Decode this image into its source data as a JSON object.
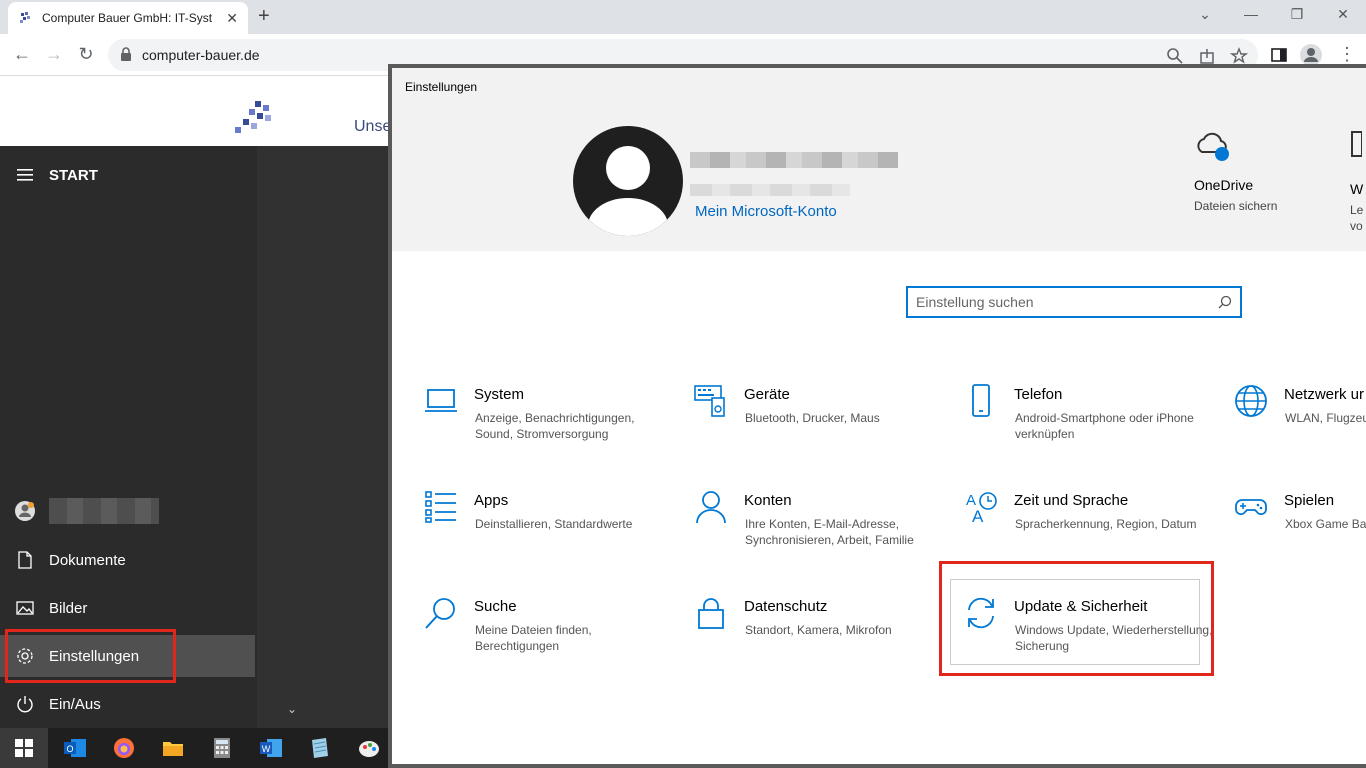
{
  "browser": {
    "tab_title": "Computer Bauer GmbH: IT-Syste",
    "url": "computer-bauer.de"
  },
  "page": {
    "partial_text": "Unse"
  },
  "start_menu": {
    "header": "START",
    "items": [
      {
        "label": "Dokumente",
        "icon": "document-icon"
      },
      {
        "label": "Bilder",
        "icon": "pictures-icon"
      },
      {
        "label": "Einstellungen",
        "icon": "gear-icon"
      },
      {
        "label": "Ein/Aus",
        "icon": "power-icon"
      }
    ]
  },
  "taskbar": {
    "apps": [
      "outlook-icon",
      "firefox-icon",
      "explorer-icon",
      "calculator-icon",
      "word-icon",
      "notepad-icon",
      "paint-icon"
    ]
  },
  "settings": {
    "window_title": "Einstellungen",
    "account_link": "Mein Microsoft-Konto",
    "onedrive": {
      "label": "OneDrive",
      "sub": "Dateien sichern"
    },
    "peek": {
      "label": "W",
      "sub1": "Le",
      "sub2": "vo"
    },
    "search_placeholder": "Einstellung suchen",
    "categories": [
      {
        "title": "System",
        "subtitle": "Anzeige, Benachrichtigungen, Sound, Stromversorgung"
      },
      {
        "title": "Geräte",
        "subtitle": "Bluetooth, Drucker, Maus"
      },
      {
        "title": "Telefon",
        "subtitle": "Android-Smartphone oder iPhone verknüpfen"
      },
      {
        "title": "Netzwerk ur",
        "subtitle": "WLAN, Flugzeu"
      },
      {
        "title": "Apps",
        "subtitle": "Deinstallieren, Standardwerte"
      },
      {
        "title": "Konten",
        "subtitle": "Ihre Konten, E-Mail-Adresse, Synchronisieren, Arbeit, Familie"
      },
      {
        "title": "Zeit und Sprache",
        "subtitle": "Spracherkennung, Region, Datum"
      },
      {
        "title": "Spielen",
        "subtitle": "Xbox Game Bar Aufzeichnunge"
      },
      {
        "title": "Suche",
        "subtitle": "Meine Dateien finden, Berechtigungen"
      },
      {
        "title": "Datenschutz",
        "subtitle": "Standort, Kamera, Mikrofon"
      },
      {
        "title": "Update & Sicherheit",
        "subtitle": "Windows Update, Wiederherstellung, Sicherung"
      }
    ]
  },
  "colors": {
    "accent": "#0078d4",
    "highlight": "#e1261c"
  }
}
